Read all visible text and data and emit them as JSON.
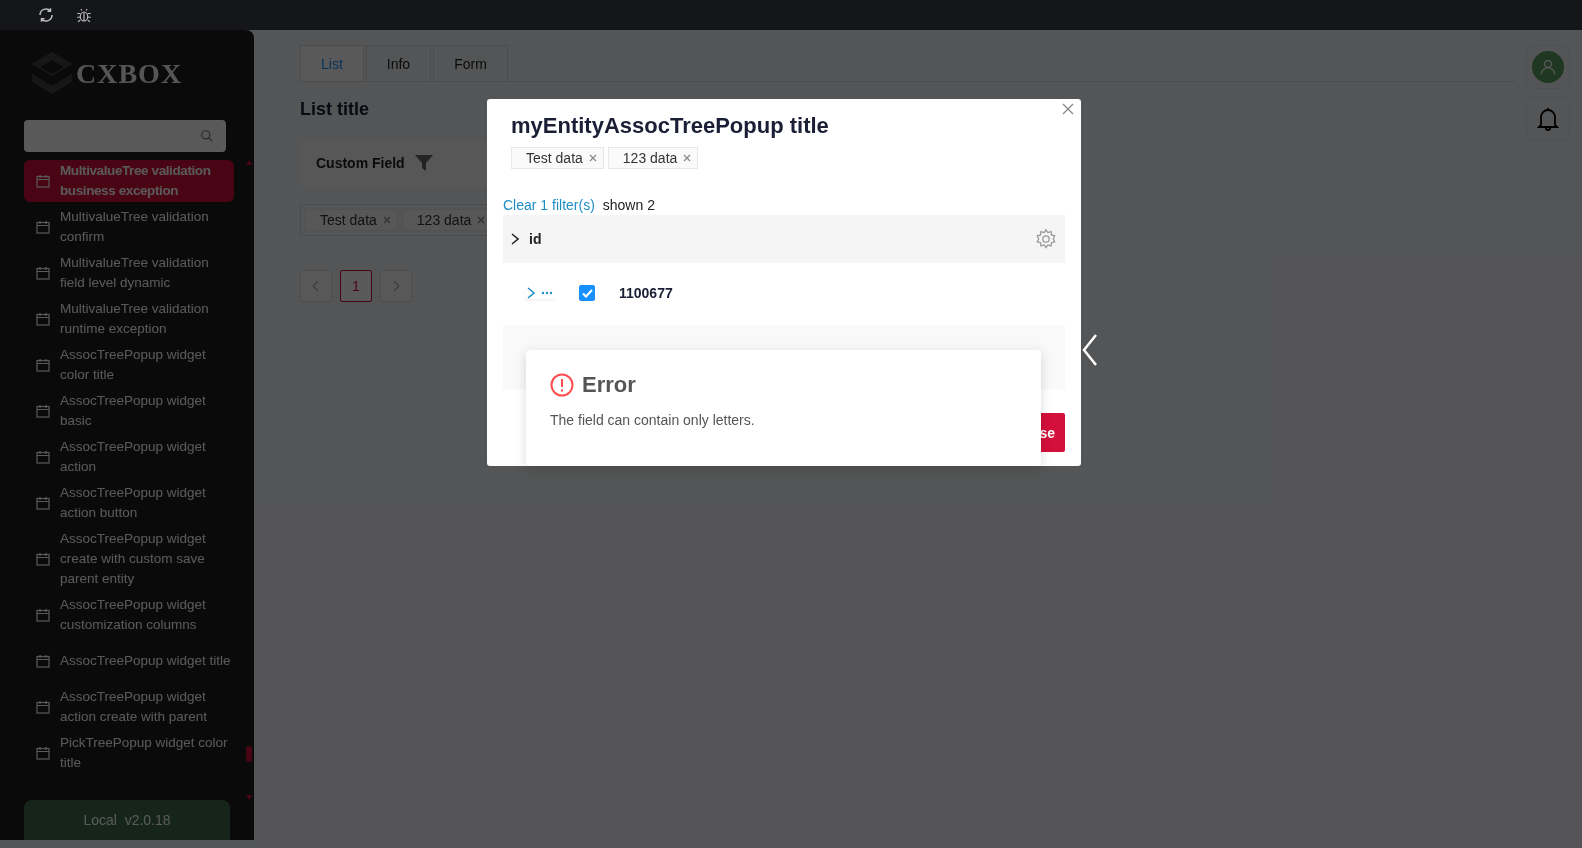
{
  "sidebar": {
    "logo_text": "CXBOX",
    "items": [
      {
        "label": "MultivalueTree validation business exception",
        "selected": true
      },
      {
        "label": "MultivalueTree validation confirm",
        "selected": false
      },
      {
        "label": "MultivalueTree validation field level dynamic",
        "selected": false
      },
      {
        "label": "MultivalueTree validation runtime exception",
        "selected": false
      },
      {
        "label": "AssocTreePopup widget color title",
        "selected": false
      },
      {
        "label": "AssocTreePopup widget basic",
        "selected": false
      },
      {
        "label": "AssocTreePopup widget action",
        "selected": false
      },
      {
        "label": "AssocTreePopup widget action button",
        "selected": false
      },
      {
        "label": "AssocTreePopup widget create with custom save parent entity",
        "selected": false
      },
      {
        "label": "AssocTreePopup widget customization columns",
        "selected": false
      },
      {
        "label": "AssocTreePopup widget title",
        "selected": false
      },
      {
        "label": "AssocTreePopup widget action create with parent",
        "selected": false
      },
      {
        "label": "PickTreePopup widget color title",
        "selected": false
      }
    ],
    "version": "Local  v2.0.18"
  },
  "content": {
    "tabs": [
      {
        "label": "List",
        "selected": true
      },
      {
        "label": "Info",
        "selected": false
      },
      {
        "label": "Form",
        "selected": false
      }
    ],
    "title": "List title",
    "column": "Custom Field",
    "tags": [
      "Test data",
      "123 data"
    ],
    "pages": [
      {
        "label": "1",
        "selected": true
      }
    ]
  },
  "modal": {
    "title": "myEntityAssocTreePopup title",
    "tags": [
      "Test data",
      "123 data"
    ],
    "clear_link": "Clear 1 filter(s)",
    "count": "shown 2",
    "column": "id",
    "rows": [
      {
        "id": "1100677",
        "checked": true
      }
    ],
    "button": "se"
  },
  "error": {
    "title": "Error",
    "message": "The field can contain only letters."
  }
}
